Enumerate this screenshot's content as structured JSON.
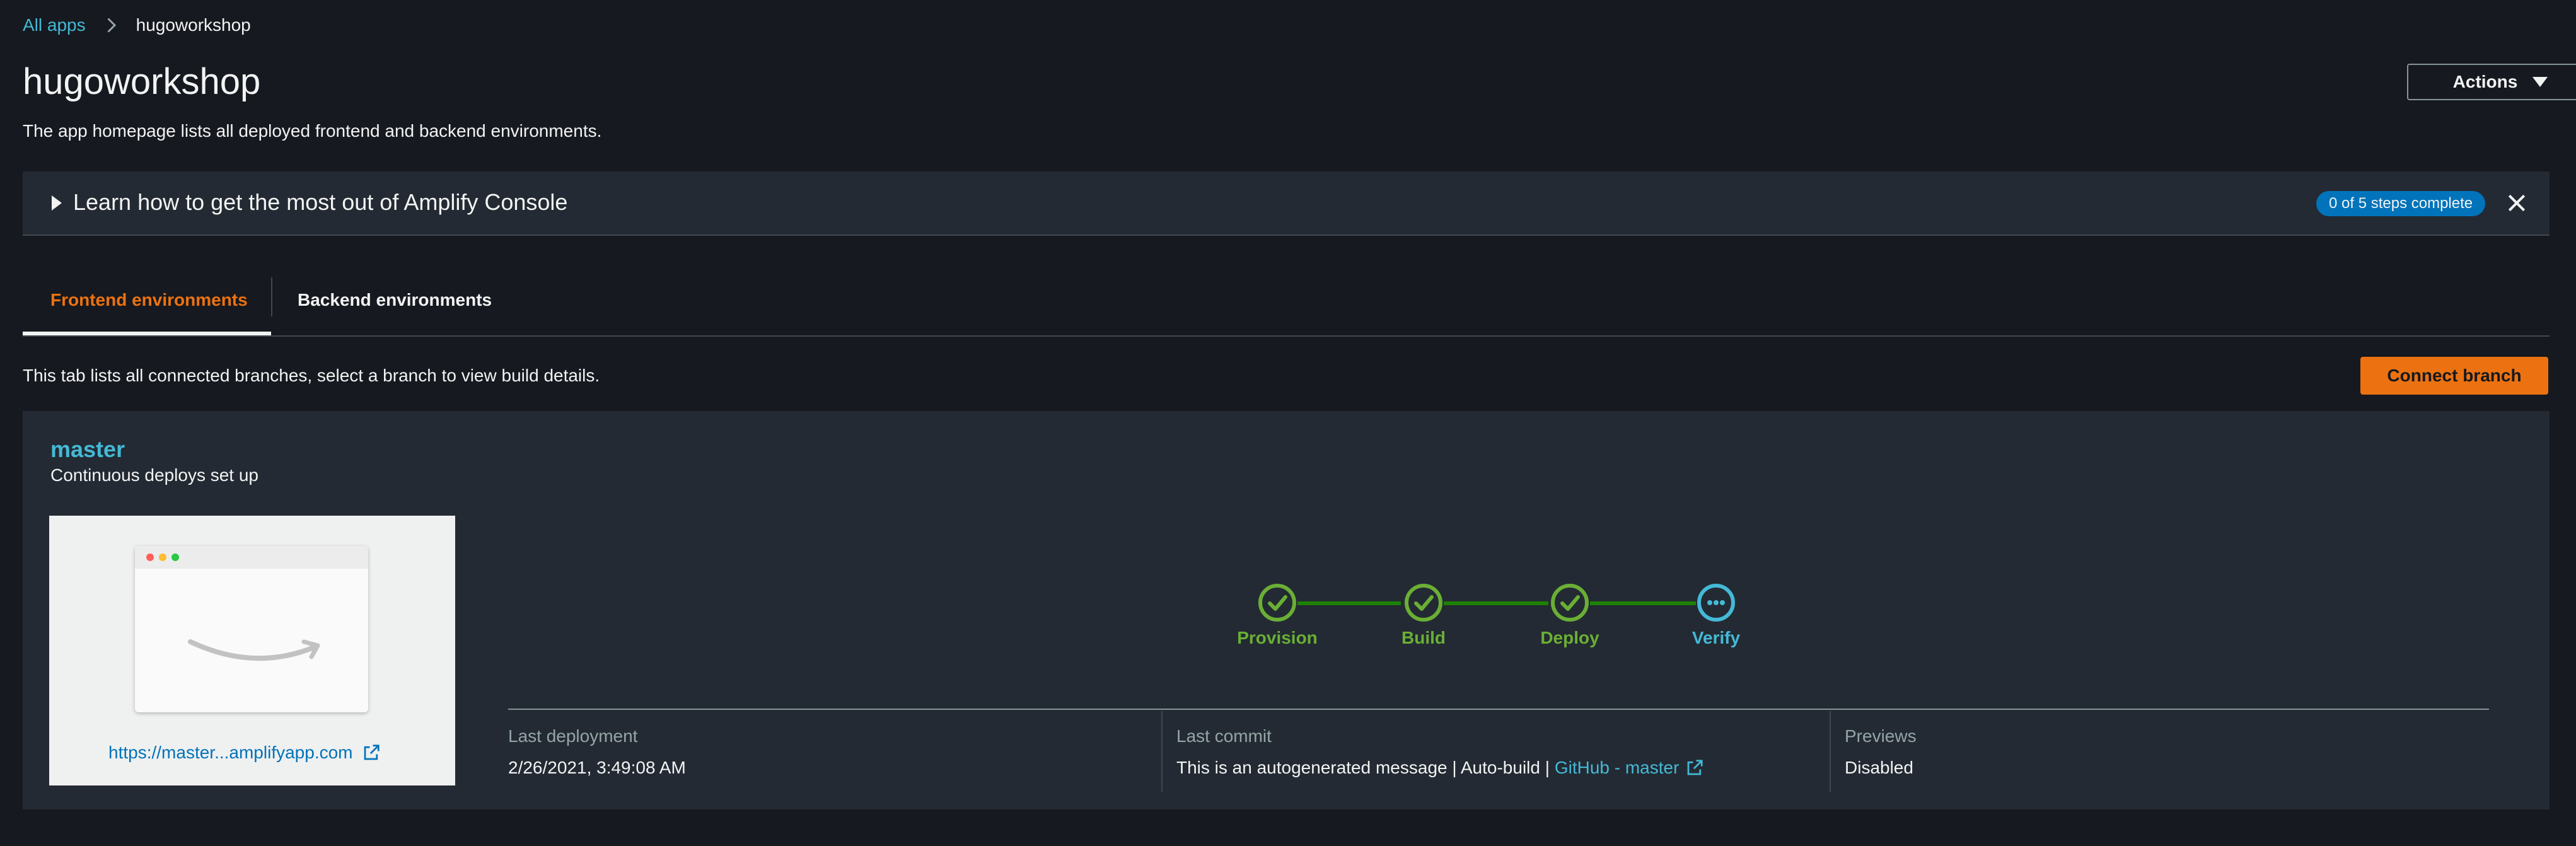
{
  "breadcrumb": {
    "root_label": "All apps",
    "current_label": "hugoworkshop"
  },
  "page": {
    "title": "hugoworkshop",
    "subtitle": "The app homepage lists all deployed frontend and backend environments."
  },
  "actions_label": "Actions",
  "learn_panel": {
    "title": "Learn how to get the most out of Amplify Console",
    "steps_badge": "0 of 5 steps complete"
  },
  "tabs": [
    {
      "label": "Frontend environments",
      "selected": true
    },
    {
      "label": "Backend environments",
      "selected": false
    }
  ],
  "tab_description": "This tab lists all connected branches, select a branch to view build details.",
  "connect_branch_label": "Connect branch",
  "branch": {
    "name": "master",
    "description": "Continuous deploys set up",
    "preview_url": "https://master...amplifyapp.com",
    "pipeline": [
      {
        "label": "Provision",
        "status": "complete"
      },
      {
        "label": "Build",
        "status": "complete"
      },
      {
        "label": "Deploy",
        "status": "complete"
      },
      {
        "label": "Verify",
        "status": "in-progress"
      }
    ],
    "details": {
      "last_deployment": {
        "label": "Last deployment",
        "value": "2/26/2021, 3:49:08 AM"
      },
      "last_commit": {
        "label": "Last commit",
        "message": "This is an autogenerated message | Auto-build | ",
        "link_label": "GitHub - master"
      },
      "previews": {
        "label": "Previews",
        "value": "Disabled"
      }
    }
  },
  "colors": {
    "background": "#16191f",
    "panel": "#232a33",
    "link": "#44b9d6",
    "accent": "#ec7211",
    "success": "#1d8102",
    "success_text": "#6aaf35",
    "info": "#0073bb"
  }
}
